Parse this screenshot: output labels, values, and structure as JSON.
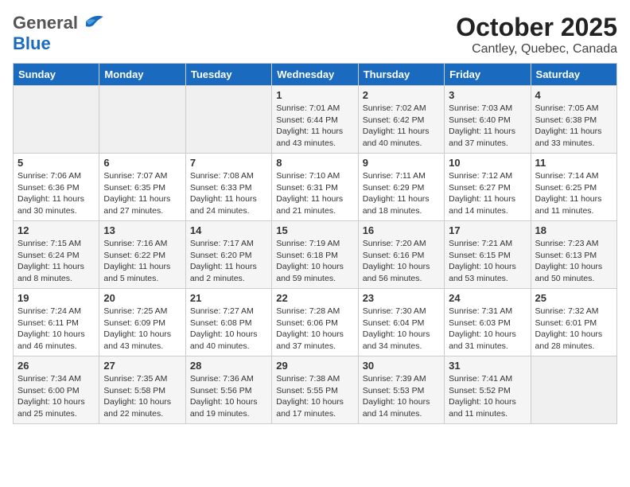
{
  "header": {
    "logo_general": "General",
    "logo_blue": "Blue",
    "title": "October 2025",
    "subtitle": "Cantley, Quebec, Canada"
  },
  "weekdays": [
    "Sunday",
    "Monday",
    "Tuesday",
    "Wednesday",
    "Thursday",
    "Friday",
    "Saturday"
  ],
  "weeks": [
    [
      {
        "day": "",
        "info": ""
      },
      {
        "day": "",
        "info": ""
      },
      {
        "day": "",
        "info": ""
      },
      {
        "day": "1",
        "info": "Sunrise: 7:01 AM\nSunset: 6:44 PM\nDaylight: 11 hours\nand 43 minutes."
      },
      {
        "day": "2",
        "info": "Sunrise: 7:02 AM\nSunset: 6:42 PM\nDaylight: 11 hours\nand 40 minutes."
      },
      {
        "day": "3",
        "info": "Sunrise: 7:03 AM\nSunset: 6:40 PM\nDaylight: 11 hours\nand 37 minutes."
      },
      {
        "day": "4",
        "info": "Sunrise: 7:05 AM\nSunset: 6:38 PM\nDaylight: 11 hours\nand 33 minutes."
      }
    ],
    [
      {
        "day": "5",
        "info": "Sunrise: 7:06 AM\nSunset: 6:36 PM\nDaylight: 11 hours\nand 30 minutes."
      },
      {
        "day": "6",
        "info": "Sunrise: 7:07 AM\nSunset: 6:35 PM\nDaylight: 11 hours\nand 27 minutes."
      },
      {
        "day": "7",
        "info": "Sunrise: 7:08 AM\nSunset: 6:33 PM\nDaylight: 11 hours\nand 24 minutes."
      },
      {
        "day": "8",
        "info": "Sunrise: 7:10 AM\nSunset: 6:31 PM\nDaylight: 11 hours\nand 21 minutes."
      },
      {
        "day": "9",
        "info": "Sunrise: 7:11 AM\nSunset: 6:29 PM\nDaylight: 11 hours\nand 18 minutes."
      },
      {
        "day": "10",
        "info": "Sunrise: 7:12 AM\nSunset: 6:27 PM\nDaylight: 11 hours\nand 14 minutes."
      },
      {
        "day": "11",
        "info": "Sunrise: 7:14 AM\nSunset: 6:25 PM\nDaylight: 11 hours\nand 11 minutes."
      }
    ],
    [
      {
        "day": "12",
        "info": "Sunrise: 7:15 AM\nSunset: 6:24 PM\nDaylight: 11 hours\nand 8 minutes."
      },
      {
        "day": "13",
        "info": "Sunrise: 7:16 AM\nSunset: 6:22 PM\nDaylight: 11 hours\nand 5 minutes."
      },
      {
        "day": "14",
        "info": "Sunrise: 7:17 AM\nSunset: 6:20 PM\nDaylight: 11 hours\nand 2 minutes."
      },
      {
        "day": "15",
        "info": "Sunrise: 7:19 AM\nSunset: 6:18 PM\nDaylight: 10 hours\nand 59 minutes."
      },
      {
        "day": "16",
        "info": "Sunrise: 7:20 AM\nSunset: 6:16 PM\nDaylight: 10 hours\nand 56 minutes."
      },
      {
        "day": "17",
        "info": "Sunrise: 7:21 AM\nSunset: 6:15 PM\nDaylight: 10 hours\nand 53 minutes."
      },
      {
        "day": "18",
        "info": "Sunrise: 7:23 AM\nSunset: 6:13 PM\nDaylight: 10 hours\nand 50 minutes."
      }
    ],
    [
      {
        "day": "19",
        "info": "Sunrise: 7:24 AM\nSunset: 6:11 PM\nDaylight: 10 hours\nand 46 minutes."
      },
      {
        "day": "20",
        "info": "Sunrise: 7:25 AM\nSunset: 6:09 PM\nDaylight: 10 hours\nand 43 minutes."
      },
      {
        "day": "21",
        "info": "Sunrise: 7:27 AM\nSunset: 6:08 PM\nDaylight: 10 hours\nand 40 minutes."
      },
      {
        "day": "22",
        "info": "Sunrise: 7:28 AM\nSunset: 6:06 PM\nDaylight: 10 hours\nand 37 minutes."
      },
      {
        "day": "23",
        "info": "Sunrise: 7:30 AM\nSunset: 6:04 PM\nDaylight: 10 hours\nand 34 minutes."
      },
      {
        "day": "24",
        "info": "Sunrise: 7:31 AM\nSunset: 6:03 PM\nDaylight: 10 hours\nand 31 minutes."
      },
      {
        "day": "25",
        "info": "Sunrise: 7:32 AM\nSunset: 6:01 PM\nDaylight: 10 hours\nand 28 minutes."
      }
    ],
    [
      {
        "day": "26",
        "info": "Sunrise: 7:34 AM\nSunset: 6:00 PM\nDaylight: 10 hours\nand 25 minutes."
      },
      {
        "day": "27",
        "info": "Sunrise: 7:35 AM\nSunset: 5:58 PM\nDaylight: 10 hours\nand 22 minutes."
      },
      {
        "day": "28",
        "info": "Sunrise: 7:36 AM\nSunset: 5:56 PM\nDaylight: 10 hours\nand 19 minutes."
      },
      {
        "day": "29",
        "info": "Sunrise: 7:38 AM\nSunset: 5:55 PM\nDaylight: 10 hours\nand 17 minutes."
      },
      {
        "day": "30",
        "info": "Sunrise: 7:39 AM\nSunset: 5:53 PM\nDaylight: 10 hours\nand 14 minutes."
      },
      {
        "day": "31",
        "info": "Sunrise: 7:41 AM\nSunset: 5:52 PM\nDaylight: 10 hours\nand 11 minutes."
      },
      {
        "day": "",
        "info": ""
      }
    ]
  ]
}
